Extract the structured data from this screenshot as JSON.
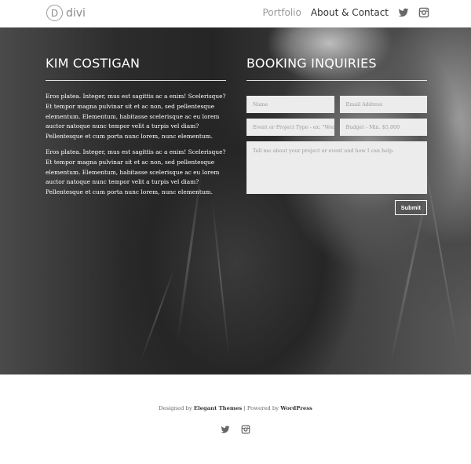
{
  "header": {
    "logo_mark": "D",
    "logo_text": "divi",
    "nav": [
      {
        "label": "Portfolio"
      },
      {
        "label": "About & Contact"
      }
    ],
    "social_icons": [
      "twitter-icon",
      "instagram-icon"
    ]
  },
  "about": {
    "title": "KIM COSTIGAN",
    "paragraphs": [
      "Eros platea. Integer, mus est sagittis ac a enim! Scelerisque? Et tempor magna pulvinar sit et ac non, sed pellentesque elementum. Elementum, habitasse scelerisque ac eu lorem auctor natoque nunc tempor velit a turpis vel diam? Pellentesque et cum porta nunc lorem, nunc elementum.",
      "Eros platea. Integer, mus est sagittis ac a enim! Scelerisque? Et tempor magna pulvinar sit et ac non, sed pellentesque elementum. Elementum, habitasse scelerisque ac eu lorem auctor natoque nunc tempor velit a turpis vel diam? Pellentesque et cum porta nunc lorem, nunc elementum."
    ]
  },
  "booking": {
    "title": "BOOKING INQUIRIES",
    "name_placeholder": "Name",
    "email_placeholder": "Email Address",
    "event_placeholder": "Event or Project Type - ex: \"Weddi",
    "budget_placeholder": "Budget - Min. $5,000",
    "message_placeholder": "Tell me about your project or event and how I can help.",
    "submit_label": "Submit"
  },
  "footer": {
    "designed_by": "Designed by",
    "elegant_themes": "Elegant Themes",
    "separator": " | Powered by ",
    "wordpress": "WordPress"
  }
}
